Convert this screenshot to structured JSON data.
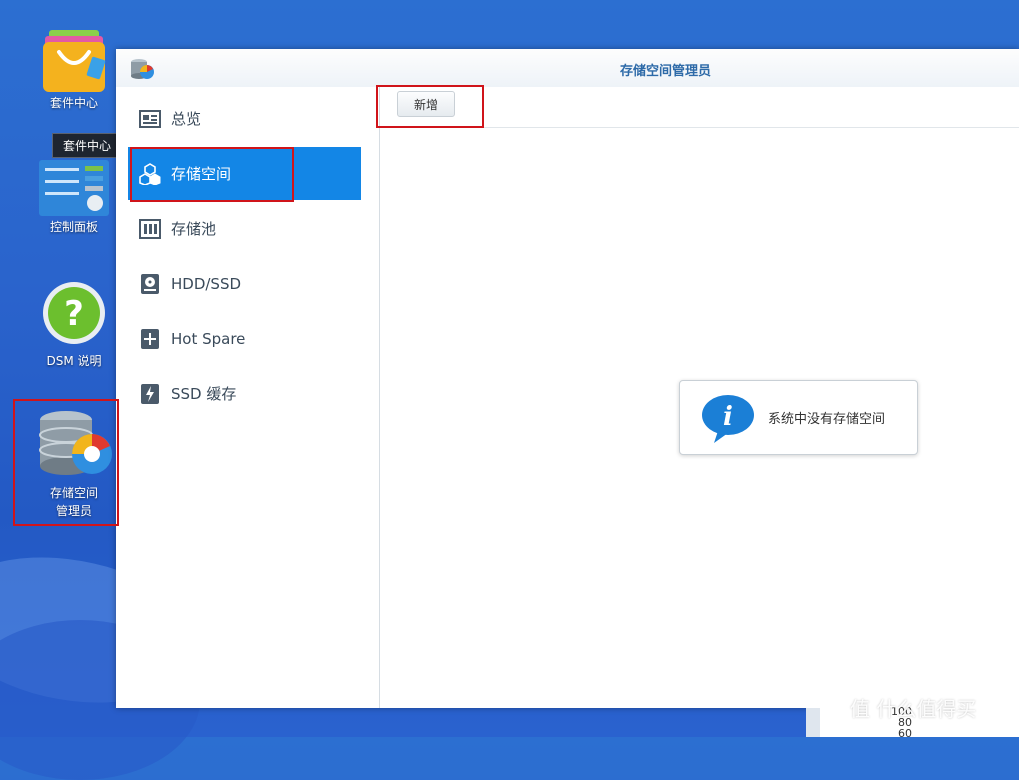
{
  "desktop": {
    "icons": [
      {
        "label": "套件中心"
      },
      {
        "label": "控制面板"
      },
      {
        "label": "DSM 说明"
      },
      {
        "label_line1": "存储空间",
        "label_line2": "管理员"
      }
    ],
    "tooltip": "套件中心",
    "watermark": "值 什么值得买",
    "corner_numbers": [
      "100",
      "80",
      "60"
    ]
  },
  "window": {
    "title": "存储空间管理员",
    "sidebar": {
      "items": [
        {
          "label": "总览",
          "icon": "overview-icon",
          "active": false
        },
        {
          "label": "存储空间",
          "icon": "volume-cubes-icon",
          "active": true
        },
        {
          "label": "存储池",
          "icon": "storage-pool-icon",
          "active": false
        },
        {
          "label": "HDD/SSD",
          "icon": "disk-icon",
          "active": false
        },
        {
          "label": "Hot Spare",
          "icon": "hot-spare-plus-icon",
          "active": false
        },
        {
          "label": "SSD 缓存",
          "icon": "ssd-cache-icon",
          "active": false
        }
      ]
    },
    "toolbar": {
      "new_label": "新增"
    },
    "empty_message": "系统中没有存储空间"
  },
  "colors": {
    "accent": "#1386e6",
    "title_text": "#2d6aa8",
    "highlight_box": "#d0141a",
    "desktop_bg": "#2a63cc"
  }
}
